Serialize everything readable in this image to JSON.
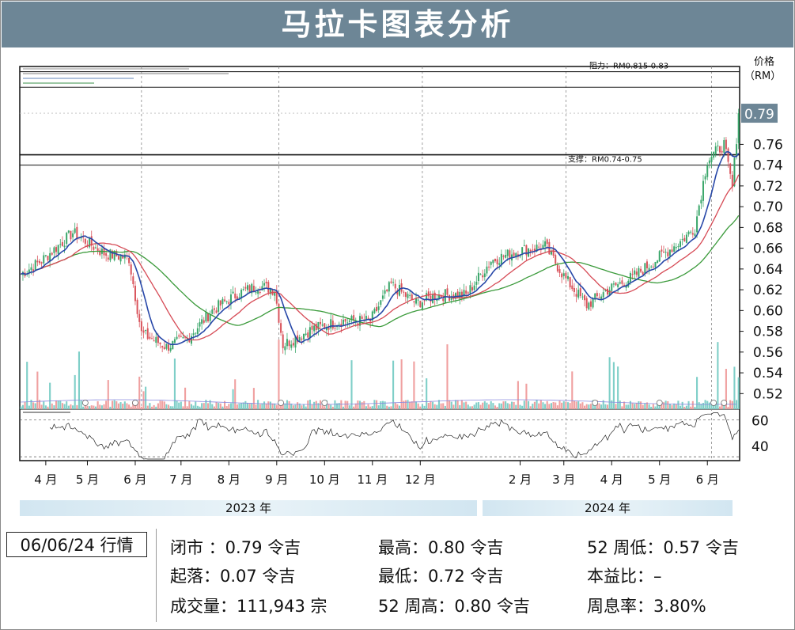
{
  "title": "马拉卡图表分析",
  "date_label": "06/06/24 行情",
  "stats": {
    "close": "闭市 ：0.79 令吉",
    "change": "起落：0.07 令吉",
    "volume": "成交量：111,943 宗",
    "high": "最高：0.80 令吉",
    "low": "最低：0.72 令吉",
    "high52": "52 周高：0.80 令吉",
    "low52": "52 周低：0.57 令吉",
    "pe": "本益比：–",
    "dy": "周息率：3.80%"
  },
  "chart_data": {
    "type": "candlestick",
    "ylabel": "价格\n（RM）",
    "ylabel_line1": "价格",
    "ylabel_line2": "（RM）",
    "ylim": [
      0.505,
      0.835
    ],
    "y_ticks": [
      "0.52",
      "0.54",
      "0.56",
      "0.58",
      "0.60",
      "0.62",
      "0.64",
      "0.66",
      "0.68",
      "0.70",
      "0.72",
      "0.74",
      "0.76"
    ],
    "y_tick_values": [
      0.52,
      0.54,
      0.56,
      0.58,
      0.6,
      0.62,
      0.64,
      0.66,
      0.68,
      0.7,
      0.72,
      0.74,
      0.76
    ],
    "last_price": "0.79",
    "last_price_value": 0.79,
    "resistance": {
      "label": "阻力：RM0.815-0.83",
      "low": 0.815,
      "high": 0.83
    },
    "support": {
      "label": "支撑：RM0.74-0.75",
      "low": 0.74,
      "high": 0.75
    },
    "months": [
      "4 月",
      "5 月",
      "6 月",
      "7 月",
      "8 月",
      "9 月",
      "10 月",
      "11 月",
      "12 月",
      "2 月",
      "3 月",
      "4 月",
      "5 月",
      "6 月"
    ],
    "month_index": [
      12,
      32,
      55,
      77,
      100,
      123,
      146,
      169,
      192,
      240,
      261,
      284,
      307,
      330
    ],
    "years": [
      "2023 年",
      "2024 年"
    ],
    "rsi_ticks": [
      "60",
      "40"
    ],
    "rsi_tick_values": [
      60,
      40
    ],
    "rsi_range": [
      28,
      78
    ],
    "series_points": [
      [
        0,
        0.635
      ],
      [
        10,
        0.648
      ],
      [
        25,
        0.675
      ],
      [
        40,
        0.655
      ],
      [
        52,
        0.65
      ],
      [
        58,
        0.578
      ],
      [
        70,
        0.565
      ],
      [
        80,
        0.573
      ],
      [
        92,
        0.6
      ],
      [
        104,
        0.616
      ],
      [
        114,
        0.624
      ],
      [
        122,
        0.62
      ],
      [
        126,
        0.567
      ],
      [
        140,
        0.582
      ],
      [
        154,
        0.59
      ],
      [
        168,
        0.59
      ],
      [
        178,
        0.625
      ],
      [
        190,
        0.607
      ],
      [
        200,
        0.615
      ],
      [
        214,
        0.615
      ],
      [
        226,
        0.648
      ],
      [
        240,
        0.658
      ],
      [
        252,
        0.662
      ],
      [
        262,
        0.63
      ],
      [
        272,
        0.605
      ],
      [
        282,
        0.62
      ],
      [
        294,
        0.632
      ],
      [
        306,
        0.65
      ],
      [
        318,
        0.668
      ],
      [
        324,
        0.68
      ],
      [
        330,
        0.745
      ],
      [
        338,
        0.76
      ],
      [
        342,
        0.718
      ],
      [
        345,
        0.79
      ]
    ],
    "total_bars": 346
  }
}
